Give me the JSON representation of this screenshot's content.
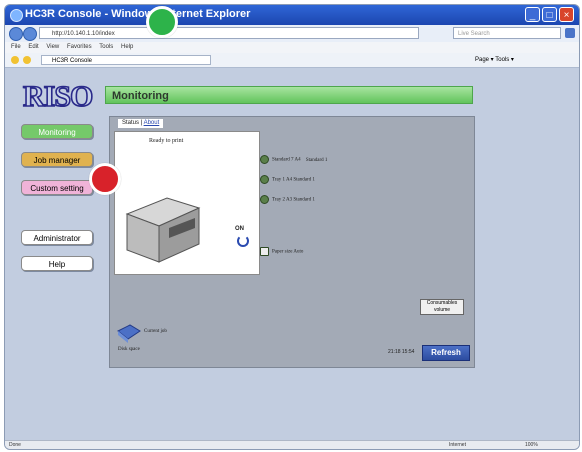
{
  "window": {
    "title": "HC3R Console - Windows Internet Explorer",
    "minimize": "_",
    "maximize": "□",
    "close": "×"
  },
  "address": {
    "url": "http://10.140.1.10/index",
    "search_placeholder": "Live Search"
  },
  "menu": {
    "items": [
      "File",
      "Edit",
      "View",
      "Favorites",
      "Tools",
      "Help"
    ]
  },
  "favorites": {
    "tab_label": "HC3R Console",
    "toolbar": "Page ▾  Tools ▾"
  },
  "app": {
    "logo": "RISO",
    "nav": [
      {
        "label": "Monitoring",
        "color": "#75c96a",
        "text_color": "#ffffff"
      },
      {
        "label": "Job manager",
        "color": "#e0b24f",
        "text_color": "#1a1a1a"
      },
      {
        "label": "Custom setting",
        "color": "#f0b3d8",
        "text_color": "#1a1a1a"
      },
      {
        "label": "Administrator",
        "color": "#ffffff",
        "text_color": "#1a1a1a"
      },
      {
        "label": "Help",
        "color": "#ffffff",
        "text_color": "#1a1a1a"
      }
    ],
    "header": "Monitoring",
    "tabs": {
      "active": "Status",
      "link": "About"
    },
    "status": "Ready to print",
    "paper_rows": [
      "Standard 7 A4",
      "Standard 1",
      "Tray 1 A4 Standard 1",
      "Tray 2 A3 Standard 1"
    ],
    "paper_size": "Paper size Auto",
    "current_job": "Current job",
    "disk_space": "Disk space",
    "time": "21:18 15:54",
    "consumables": "Consumables volume",
    "refresh": "Refresh",
    "on_label": "ON"
  },
  "statusbar": {
    "left": "Done",
    "zone": "Internet",
    "zoom": "100%"
  },
  "markers": {
    "green": "#2db34a",
    "red": "#d8222a"
  }
}
